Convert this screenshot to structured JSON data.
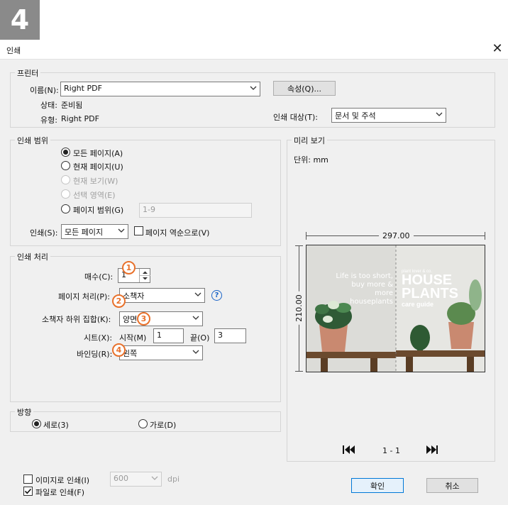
{
  "step_number": "4",
  "dialog": {
    "title": "인쇄"
  },
  "printer": {
    "legend": "프린터",
    "name_label": "이름(N):",
    "name_value": "Right PDF",
    "properties_button": "속성(Q)...",
    "status_label": "상태:",
    "status_value": "준비됨",
    "type_label": "유형:",
    "type_value": "Right PDF",
    "print_what_label": "인쇄 대상(T):",
    "print_what_value": "문서 및 주석"
  },
  "print_range": {
    "legend": "인쇄 범위",
    "all_pages": "모든 페이지(A)",
    "current_page": "현재 페이지(U)",
    "current_view": "현재 보기(W)",
    "selection": "선택 영역(E)",
    "page_range": "페이지 범위(G)",
    "page_range_value": "1-9",
    "print_label": "인쇄(S):",
    "print_value": "모든 페이지",
    "reverse_label": "페이지 역순으로(V)"
  },
  "handling": {
    "legend": "인쇄 처리",
    "copies_label": "매수(C):",
    "copies_value": "1",
    "page_scaling_label": "페이지 처리(P):",
    "page_scaling_value": "소책자",
    "booklet_subset_label": "소책자 하위 집합(K):",
    "booklet_subset_value": "양면",
    "sheets_label": "시트(X):",
    "from_label": "시작(M)",
    "from_value": "1",
    "to_label": "끝(O)",
    "to_value": "3",
    "binding_label": "바인딩(R):",
    "binding_value": "왼쪽",
    "markers": [
      "1",
      "2",
      "3",
      "4"
    ],
    "help_icon": "?"
  },
  "orientation": {
    "legend": "방향",
    "portrait": "세로(3)",
    "landscape": "가로(D)"
  },
  "preview": {
    "legend": "미리 보기",
    "units": "단위: mm",
    "width_label": "297.00",
    "height_label": "210.00",
    "page_indicator": "1 - 1",
    "left_text_1": "Life is too short,",
    "left_text_2": "buy more & more",
    "left_text_3": "houseplants",
    "brand_small": "plant lover & co.",
    "brand_line1": "HOUSE",
    "brand_line2": "PLANTS",
    "brand_line3": "care guide"
  },
  "bottom": {
    "print_as_image": "이미지로 인쇄(I)",
    "dpi_value": "600",
    "dpi_unit": "dpi",
    "print_to_file": "파일로 인쇄(F)",
    "ok": "확인",
    "cancel": "취소"
  },
  "colors": {
    "accent": "#e8702a",
    "link": "#1a64c8"
  }
}
